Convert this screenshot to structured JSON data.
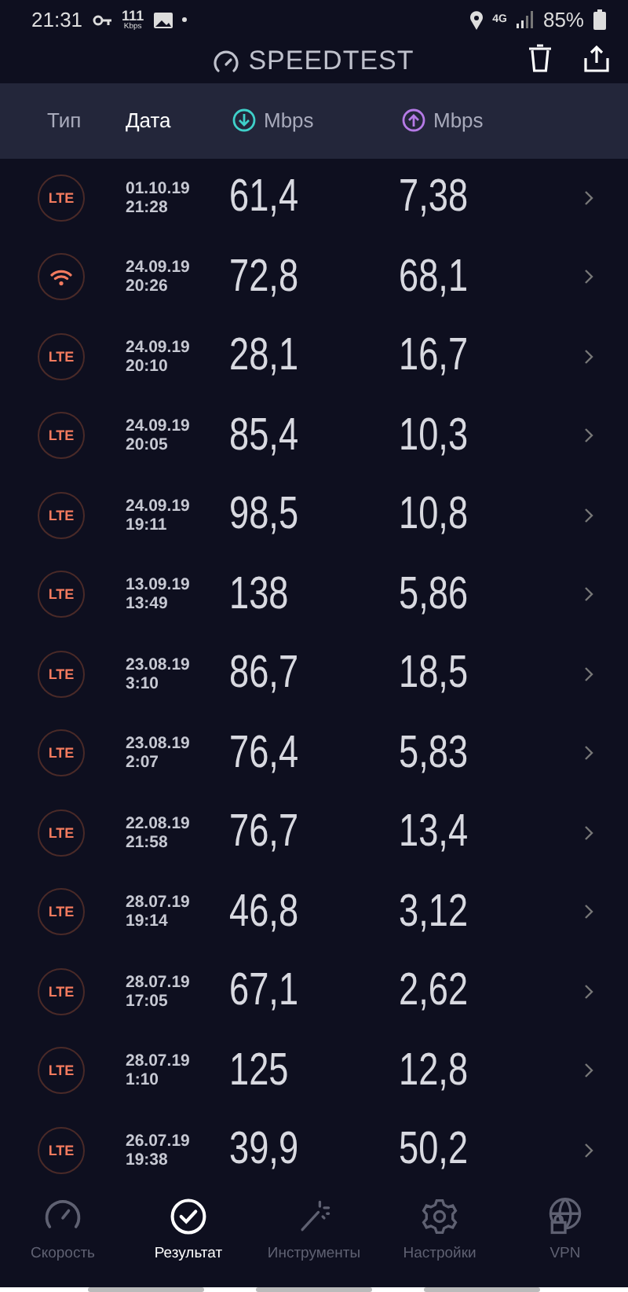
{
  "status_bar": {
    "time": "21:31",
    "speed_value": "111",
    "speed_unit": "Kbps",
    "network": "4G",
    "battery": "85%"
  },
  "header": {
    "title": "SPEEDTEST"
  },
  "columns": {
    "type": "Тип",
    "date": "Дата",
    "download": "Mbps",
    "upload": "Mbps"
  },
  "results": [
    {
      "kind": "lte",
      "label": "LTE",
      "date": "01.10.19",
      "time": "21:28",
      "download": "61,4",
      "upload": "7,38"
    },
    {
      "kind": "wifi",
      "date": "24.09.19",
      "time": "20:26",
      "download": "72,8",
      "upload": "68,1"
    },
    {
      "kind": "lte",
      "label": "LTE",
      "date": "24.09.19",
      "time": "20:10",
      "download": "28,1",
      "upload": "16,7"
    },
    {
      "kind": "lte",
      "label": "LTE",
      "date": "24.09.19",
      "time": "20:05",
      "download": "85,4",
      "upload": "10,3"
    },
    {
      "kind": "lte",
      "label": "LTE",
      "date": "24.09.19",
      "time": "19:11",
      "download": "98,5",
      "upload": "10,8"
    },
    {
      "kind": "lte",
      "label": "LTE",
      "date": "13.09.19",
      "time": "13:49",
      "download": "138",
      "upload": "5,86"
    },
    {
      "kind": "lte",
      "label": "LTE",
      "date": "23.08.19",
      "time": "3:10",
      "download": "86,7",
      "upload": "18,5"
    },
    {
      "kind": "lte",
      "label": "LTE",
      "date": "23.08.19",
      "time": "2:07",
      "download": "76,4",
      "upload": "5,83"
    },
    {
      "kind": "lte",
      "label": "LTE",
      "date": "22.08.19",
      "time": "21:58",
      "download": "76,7",
      "upload": "13,4"
    },
    {
      "kind": "lte",
      "label": "LTE",
      "date": "28.07.19",
      "time": "19:14",
      "download": "46,8",
      "upload": "3,12"
    },
    {
      "kind": "lte",
      "label": "LTE",
      "date": "28.07.19",
      "time": "17:05",
      "download": "67,1",
      "upload": "2,62"
    },
    {
      "kind": "lte",
      "label": "LTE",
      "date": "28.07.19",
      "time": "1:10",
      "download": "125",
      "upload": "12,8"
    },
    {
      "kind": "lte",
      "label": "LTE",
      "date": "26.07.19",
      "time": "19:38",
      "download": "39,9",
      "upload": "50,2"
    }
  ],
  "nav": [
    {
      "kind": "speed",
      "label": "Скорость",
      "selected": false
    },
    {
      "kind": "results",
      "label": "Результат",
      "selected": true
    },
    {
      "kind": "tools",
      "label": "Инструменты",
      "selected": false
    },
    {
      "kind": "settings",
      "label": "Настройки",
      "selected": false
    },
    {
      "kind": "vpn",
      "label": "VPN",
      "selected": false
    }
  ]
}
